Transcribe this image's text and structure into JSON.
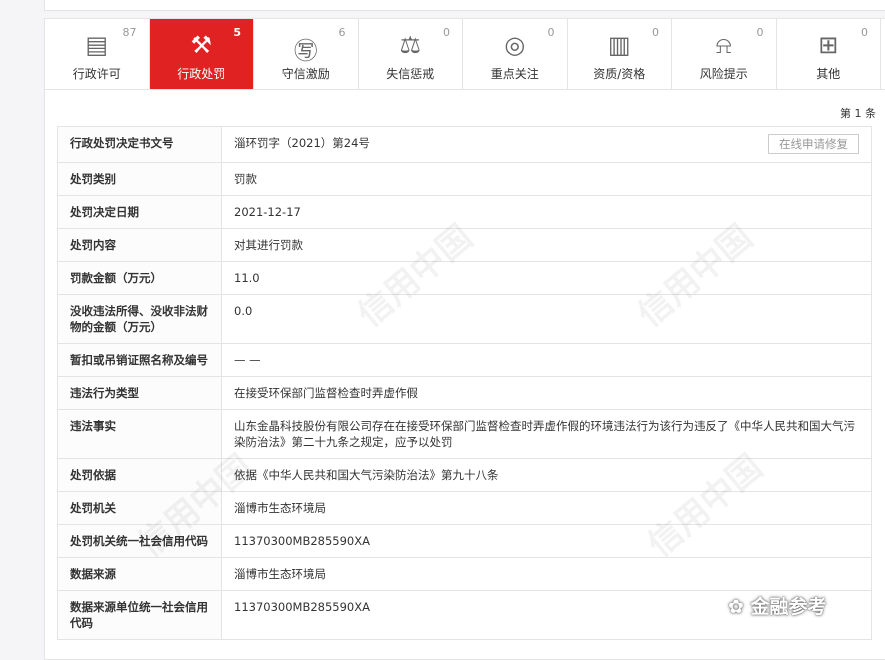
{
  "tabs": [
    {
      "label": "行政许可",
      "count": "87",
      "icon": "license-icon"
    },
    {
      "label": "行政处罚",
      "count": "5",
      "icon": "gavel-icon",
      "active": true
    },
    {
      "label": "守信激励",
      "count": "6",
      "icon": "credit-medal-icon"
    },
    {
      "label": "失信惩戒",
      "count": "0",
      "icon": "scales-icon"
    },
    {
      "label": "重点关注",
      "count": "0",
      "icon": "target-icon"
    },
    {
      "label": "资质/资格",
      "count": "0",
      "icon": "certificate-icon"
    },
    {
      "label": "风险提示",
      "count": "0",
      "icon": "alarm-icon"
    },
    {
      "label": "其他",
      "count": "0",
      "icon": "document-grid-icon"
    }
  ],
  "record_count": "第 1 条",
  "repair_button": "在线申请修复",
  "rows": [
    {
      "k": "行政处罚决定书文号",
      "v": "淄环罚字（2021）第24号"
    },
    {
      "k": "处罚类别",
      "v": "罚款"
    },
    {
      "k": "处罚决定日期",
      "v": "2021-12-17"
    },
    {
      "k": "处罚内容",
      "v": "对其进行罚款"
    },
    {
      "k": "罚款金额（万元）",
      "v": "11.0"
    },
    {
      "k": "没收违法所得、没收非法财物的金额（万元）",
      "v": "0.0"
    },
    {
      "k": "暂扣或吊销证照名称及编号",
      "v": "— —"
    },
    {
      "k": "违法行为类型",
      "v": "在接受环保部门监督检查时弄虚作假"
    },
    {
      "k": "违法事实",
      "v": "山东金晶科技股份有限公司存在在接受环保部门监督检查时弄虚作假的环境违法行为该行为违反了《中华人民共和国大气污染防治法》第二十九条之规定，应予以处罚"
    },
    {
      "k": "处罚依据",
      "v": "依据《中华人民共和国大气污染防治法》第九十八条"
    },
    {
      "k": "处罚机关",
      "v": "淄博市生态环境局"
    },
    {
      "k": "处罚机关统一社会信用代码",
      "v": "11370300MB285590XA"
    },
    {
      "k": "数据来源",
      "v": "淄博市生态环境局"
    },
    {
      "k": "数据来源单位统一社会信用代码",
      "v": "11370300MB285590XA"
    }
  ],
  "watermark": "信用中国",
  "brand": "金融参考",
  "colors": {
    "accent": "#e02222"
  }
}
